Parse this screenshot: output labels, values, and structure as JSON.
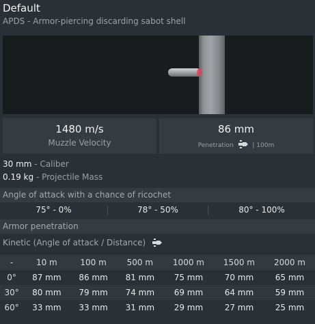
{
  "header": {
    "title": "Default",
    "subtitle": "APDS - Armor-piercing discarding sabot shell"
  },
  "stats": {
    "muzzle_velocity": {
      "value": "1480 m/s",
      "label": "Muzzle Velocity"
    },
    "penetration": {
      "value": "86 mm",
      "label": "Penetration",
      "distance": "| 100m",
      "icon": "penetration-shell-icon"
    }
  },
  "properties": [
    {
      "value": "30 mm",
      "label": "- Caliber"
    },
    {
      "value": "0.19 kg",
      "label": "- Projectile Mass"
    }
  ],
  "ricochet": {
    "title": "Angle of attack with a chance of ricochet",
    "cells": [
      "75° - 0%",
      "78° - 50%",
      "80° - 100%"
    ]
  },
  "armor": {
    "title": "Armor penetration",
    "kinetic_label": "Kinetic (Angle of attack / Distance)",
    "kinetic_icon": "shell-icon",
    "columns": [
      "-",
      "10 m",
      "100 m",
      "500 m",
      "1000 m",
      "1500 m",
      "2000 m"
    ],
    "rows": [
      {
        "angle": "0°",
        "values": [
          "87 mm",
          "86 mm",
          "81 mm",
          "75 mm",
          "70 mm",
          "65 mm"
        ]
      },
      {
        "angle": "30°",
        "values": [
          "80 mm",
          "79 mm",
          "74 mm",
          "69 mm",
          "64 mm",
          "59 mm"
        ]
      },
      {
        "angle": "60°",
        "values": [
          "33 mm",
          "33 mm",
          "31 mm",
          "29 mm",
          "27 mm",
          "25 mm"
        ]
      }
    ]
  },
  "colors": {
    "background": "#2a3035",
    "card": "#353b40",
    "muted_text": "#9aa1a6",
    "shell_tip": "#e0445a"
  }
}
